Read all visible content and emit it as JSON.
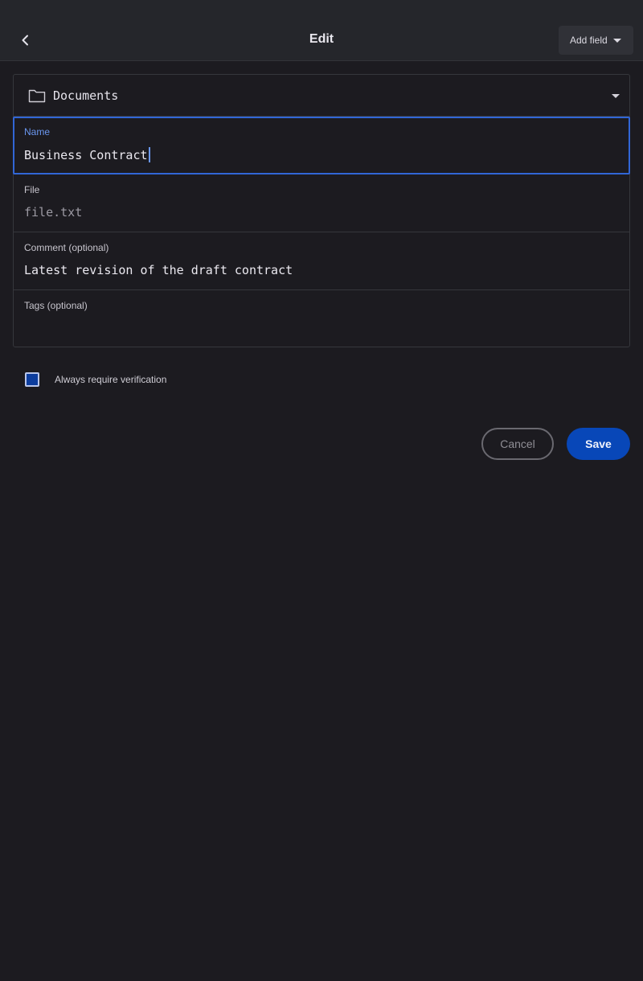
{
  "header": {
    "title": "Edit",
    "back_icon": "chevron-left-icon",
    "add_field_label": "Add field"
  },
  "folder": {
    "icon": "folder-icon",
    "label": "Documents"
  },
  "fields": {
    "name": {
      "label": "Name",
      "value": "Business Contract"
    },
    "file": {
      "label": "File",
      "value": "file.txt"
    },
    "comment": {
      "label": "Comment (optional)",
      "value": "Latest revision of the draft contract"
    },
    "tags": {
      "label": "Tags (optional)",
      "value": ""
    }
  },
  "verification": {
    "label": "Always require verification",
    "checked": false
  },
  "actions": {
    "cancel_label": "Cancel",
    "save_label": "Save"
  },
  "colors": {
    "background": "#1c1b20",
    "accent": "#3166d6",
    "save_button": "#0847b8"
  }
}
